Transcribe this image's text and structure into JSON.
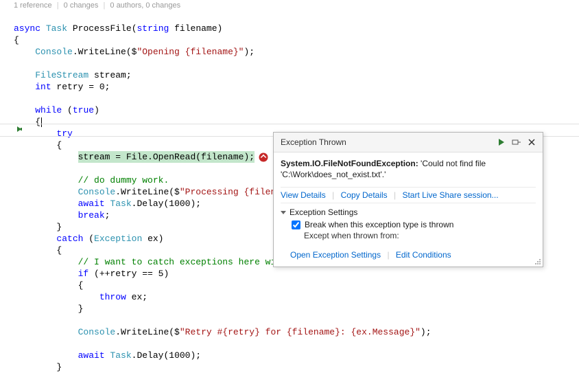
{
  "codelens": {
    "ref": "1 reference",
    "ch1": "0 changes",
    "auth": "0 authors, 0 changes"
  },
  "code": {
    "l1_async": "async",
    "l1_task": "Task",
    "l1_method": "ProcessFile",
    "l1_params_open": "(",
    "l1_string": "string",
    "l1_param": " filename)",
    "l2": "{",
    "l3_pad": "    ",
    "l3_console": "Console",
    "l3_dot": ".WriteLine($",
    "l3_str": "\"Opening {filename}\"",
    "l3_end": ");",
    "l5_pad": "    ",
    "l5_type": "FileStream",
    "l5_rest": " stream;",
    "l6_pad": "    ",
    "l6_int": "int",
    "l6_rest": " retry = 0;",
    "l8_pad": "    ",
    "l8_while": "while",
    "l8_rest": " (",
    "l8_true": "true",
    "l8_close": ")",
    "l9_pad": "    {",
    "l10_pad": "        ",
    "l10_try": "try",
    "l11_pad": "        {",
    "l12_pad": "            ",
    "l12_hl": "stream = File.OpenRead(filename);",
    "l14_pad": "            ",
    "l14_comment": "// do dummy work.",
    "l15_pad": "            ",
    "l15_console": "Console",
    "l15_dot": ".WriteLine($",
    "l15_str": "\"Processing {filen",
    "l16_pad": "            ",
    "l16_await": "await",
    "l16_task": " Task",
    "l16_rest": ".Delay(1000);",
    "l17_pad": "            ",
    "l17_break": "break",
    "l17_semi": ";",
    "l18_pad": "        }",
    "l19_pad": "        ",
    "l19_catch": "catch",
    "l19_sp": " (",
    "l19_exc": "Exception",
    "l19_rest": " ex)",
    "l20_pad": "        {",
    "l21_pad": "            ",
    "l21_comment": "// I want to catch exceptions here wit",
    "l22_pad": "            ",
    "l22_if": "if",
    "l22_rest": " (++retry == 5)",
    "l23_pad": "            {",
    "l24_pad": "                ",
    "l24_throw": "throw",
    "l24_rest": " ex;",
    "l25_pad": "            }",
    "l27_pad": "            ",
    "l27_console": "Console",
    "l27_dot": ".WriteLine($",
    "l27_str": "\"Retry #{retry} for {filename}: {ex.Message}\"",
    "l27_end": ");",
    "l29_pad": "            ",
    "l29_await": "await",
    "l29_task": " Task",
    "l29_rest": ".Delay(1000);",
    "l30_pad": "        }"
  },
  "popup": {
    "title": "Exception Thrown",
    "exc_name": "System.IO.FileNotFoundException:",
    "exc_msg": " 'Could not find file 'C:\\Work\\does_not_exist.txt'.'",
    "view_details": "View Details",
    "copy_details": "Copy Details",
    "live_share": "Start Live Share session...",
    "settings_hdr": "Exception Settings",
    "break_chk": "Break when this exception type is thrown",
    "except_when": "Except when thrown from:",
    "open_settings": "Open Exception Settings",
    "edit_cond": "Edit Conditions"
  }
}
